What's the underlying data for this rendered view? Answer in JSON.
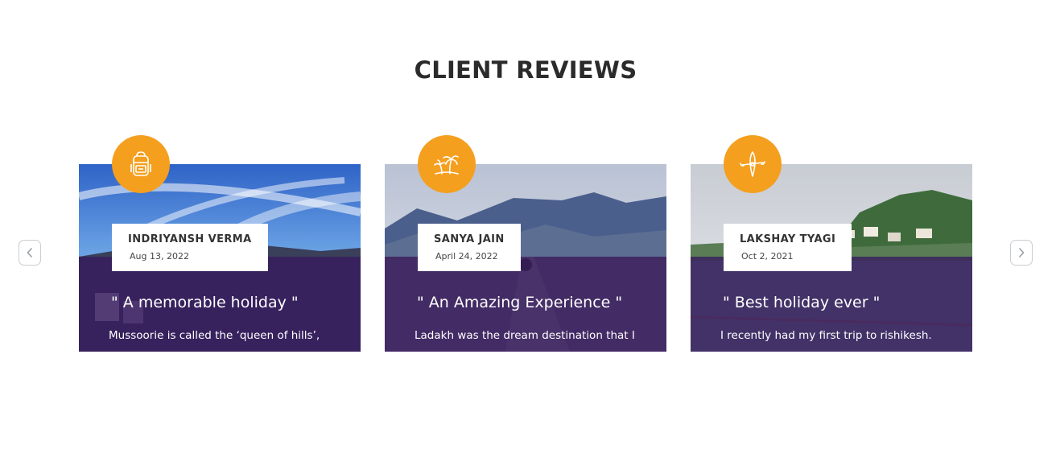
{
  "section": {
    "title": "CLIENT REVIEWS"
  },
  "navigation": {
    "prev_icon": "chevron-left-icon",
    "next_icon": "chevron-right-icon"
  },
  "colors": {
    "accent": "#f59f1f",
    "overlay": "#37195f",
    "border": "#c9cdd1"
  },
  "reviews": [
    {
      "name": "INDRIYANSH VERMA",
      "date": "Aug 13, 2022",
      "title": "\" A memorable holiday \"",
      "excerpt": "Mussoorie is called the ‘queen of hills’,",
      "icon": "backpack-icon",
      "image": "sky-hills-photo"
    },
    {
      "name": "SANYA JAIN",
      "date": "April 24, 2022",
      "title": "\" An Amazing Experience \"",
      "excerpt": "Ladakh was the dream destination that I",
      "icon": "palm-trees-icon",
      "image": "mountain-road-photo"
    },
    {
      "name": "LAKSHAY TYAGI",
      "date": "Oct 2, 2021",
      "title": "\" Best holiday ever \"",
      "excerpt": "I recently had my first trip to rishikesh.",
      "icon": "kayak-icon",
      "image": "hillside-town-photo"
    }
  ]
}
